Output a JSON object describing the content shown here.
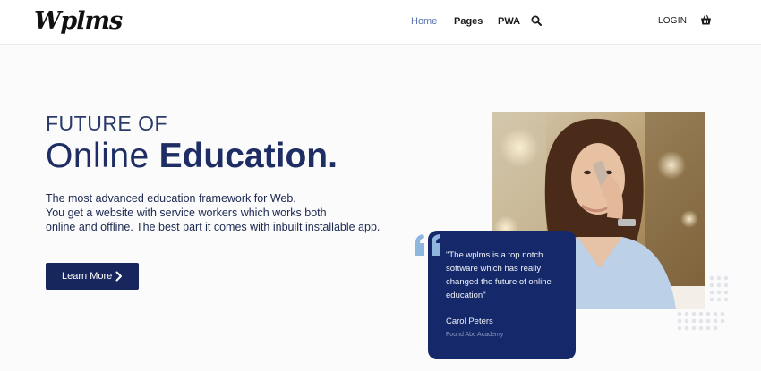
{
  "header": {
    "logo": "Wplms",
    "nav": [
      {
        "label": "Home",
        "active": true
      },
      {
        "label": "Pages",
        "active": false
      },
      {
        "label": "PWA",
        "active": false
      }
    ],
    "search_icon": "search-icon",
    "login_label": "LOGIN",
    "cart_icon": "cart-icon"
  },
  "hero": {
    "kicker": "FUTURE OF",
    "title_light": "Online",
    "title_bold": "Education.",
    "description_lines": [
      "The most advanced education framework for Web.",
      "You get a website with service workers which works both",
      "online and offline. The best part it comes with inbuilt installable app."
    ],
    "cta_label": "Learn More",
    "cta_icon": "chevron-right-icon"
  },
  "testimonial": {
    "quote_icon": "quote-icon",
    "quote_lines": [
      "\"The wplms is a top notch",
      "software which has really",
      "changed the future of online",
      "education\""
    ],
    "author_name": "Carol Peters",
    "author_role": "Found Abc Academy"
  },
  "colors": {
    "navy": "#17275e",
    "card": "#15296a",
    "accent_blue": "#5a72b0",
    "quote_light_blue": "#8fb6dd"
  }
}
